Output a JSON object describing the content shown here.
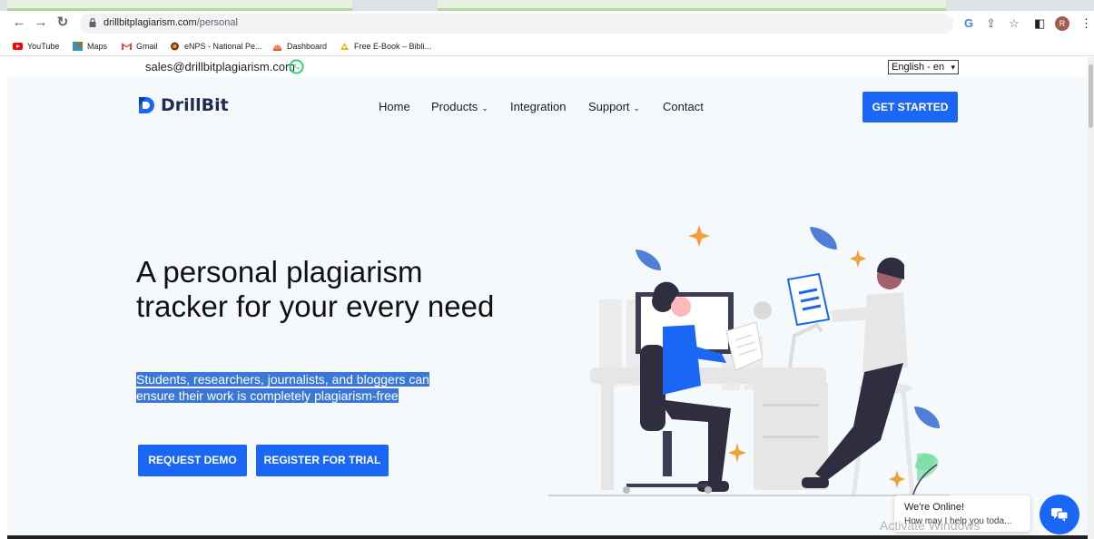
{
  "browser": {
    "url_host": "drillbitplagiarism.com",
    "url_path": "/personal",
    "avatar_letter": "R",
    "bookmarks": [
      {
        "label": "YouTube"
      },
      {
        "label": "Maps"
      },
      {
        "label": "Gmail"
      },
      {
        "label": "eNPS - National Pe..."
      },
      {
        "label": "Dashboard"
      },
      {
        "label": "Free E-Book – Bibli..."
      }
    ]
  },
  "topbar": {
    "email": "sales@drillbitplagiarism.com",
    "language": "English - en"
  },
  "header": {
    "logo_text": "DrillBit",
    "nav": {
      "home": "Home",
      "products": "Products",
      "integration": "Integration",
      "support": "Support",
      "contact": "Contact"
    },
    "cta": "GET STARTED"
  },
  "hero": {
    "headline": "A personal plagiarism tracker for your every need",
    "subtext": "Students, researchers, journalists, and bloggers can ensure their work is completely plagiarism-free",
    "request_demo": "REQUEST DEMO",
    "register_trial": "REGISTER FOR TRIAL"
  },
  "chat": {
    "status": "We're Online!",
    "prompt": "How may I help you toda..."
  },
  "watermark": "Activate Windows",
  "colors": {
    "accent": "#1a66f5",
    "hero_bg": "#f6f9fc",
    "selection": "#3a77d9"
  }
}
